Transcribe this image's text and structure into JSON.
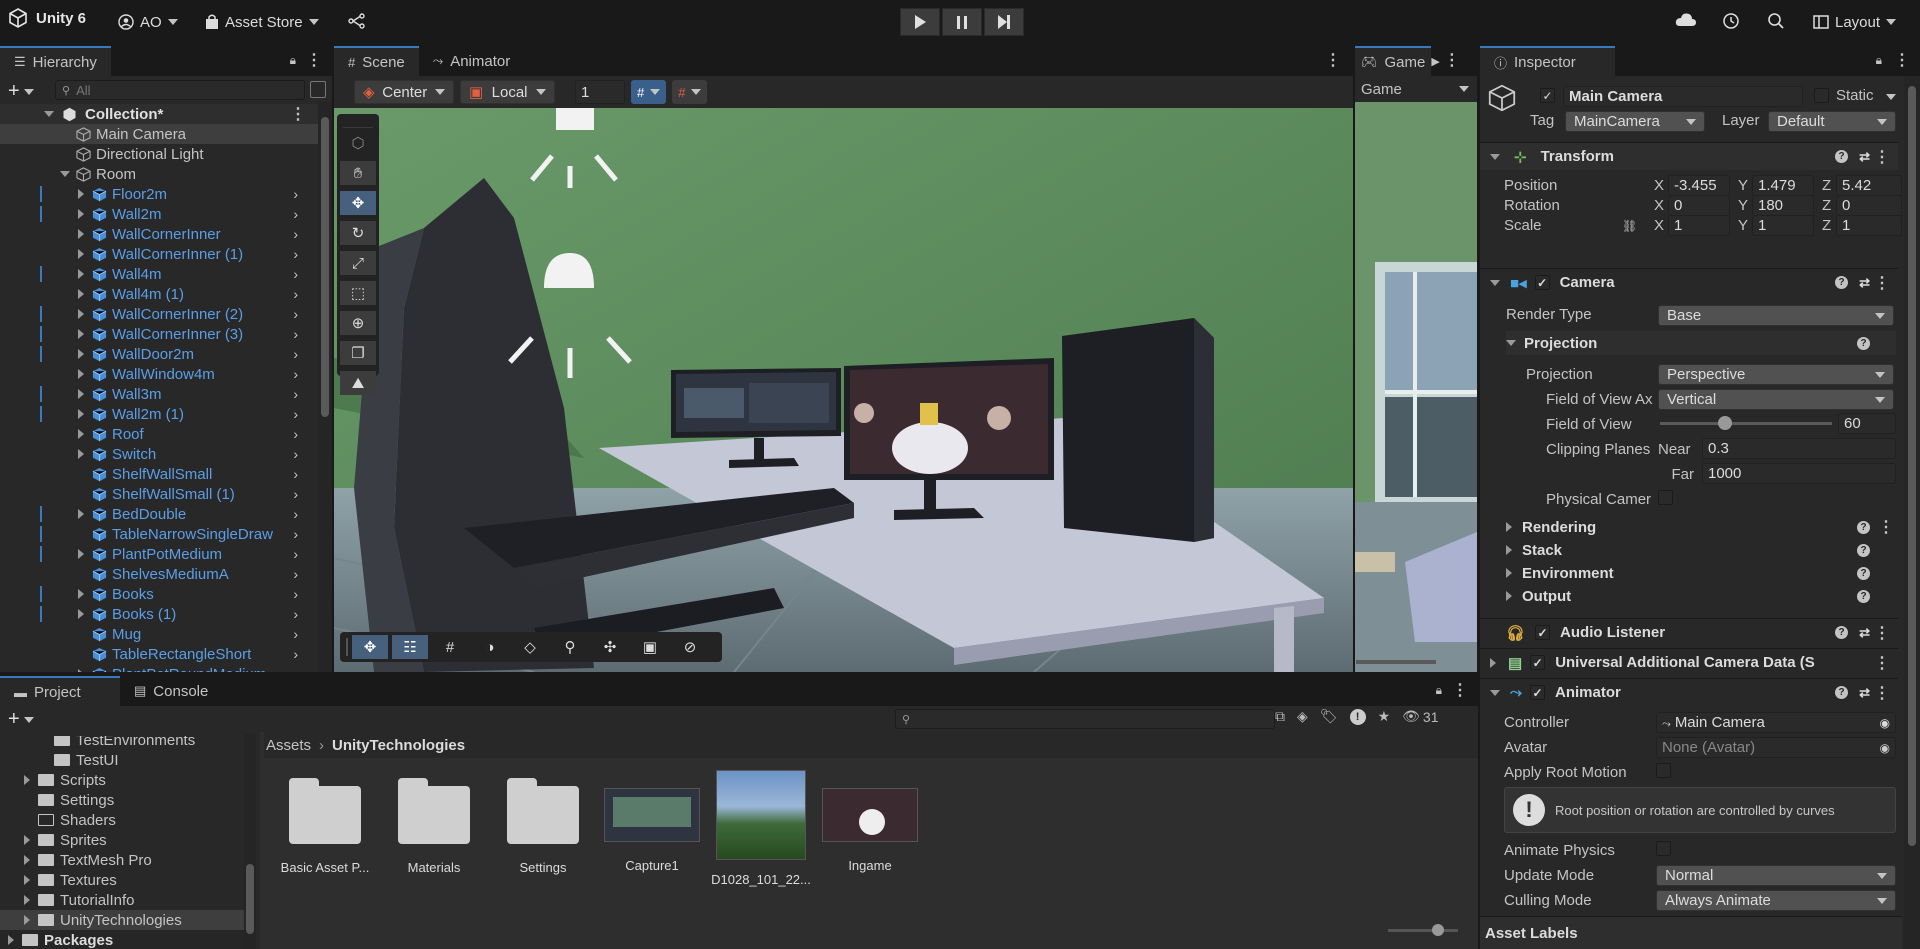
{
  "topbar": {
    "app_name": "Unity 6",
    "account": "AO",
    "asset_store": "Asset Store",
    "layout": "Layout"
  },
  "hierarchy": {
    "tab": "Hierarchy",
    "search_placeholder": "All",
    "scene": "Collection*",
    "items": [
      {
        "label": "Main Camera"
      },
      {
        "label": "Directional Light"
      },
      {
        "label": "Room"
      },
      {
        "label": "Floor2m"
      },
      {
        "label": "Wall2m"
      },
      {
        "label": "WallCornerInner"
      },
      {
        "label": "WallCornerInner (1)"
      },
      {
        "label": "Wall4m"
      },
      {
        "label": "Wall4m (1)"
      },
      {
        "label": "WallCornerInner (2)"
      },
      {
        "label": "WallCornerInner (3)"
      },
      {
        "label": "WallDoor2m"
      },
      {
        "label": "WallWindow4m"
      },
      {
        "label": "Wall3m"
      },
      {
        "label": "Wall2m (1)"
      },
      {
        "label": "Roof"
      },
      {
        "label": "Switch"
      },
      {
        "label": "ShelfWallSmall"
      },
      {
        "label": "ShelfWallSmall (1)"
      },
      {
        "label": "BedDouble"
      },
      {
        "label": "TableNarrowSingleDraw"
      },
      {
        "label": "PlantPotMedium"
      },
      {
        "label": "ShelvesMediumA"
      },
      {
        "label": "Books"
      },
      {
        "label": "Books (1)"
      },
      {
        "label": "Mug"
      },
      {
        "label": "TableRectangleShort"
      },
      {
        "label": "PlantPotRoundMedium"
      }
    ]
  },
  "scene": {
    "tabs": [
      "Scene",
      "Animator"
    ],
    "pivot": "Center",
    "space": "Local",
    "snap_value": "1"
  },
  "game": {
    "tab": "Game",
    "display": "Game"
  },
  "inspector": {
    "tab": "Inspector",
    "object_name": "Main Camera",
    "static_label": "Static",
    "tag_label": "Tag",
    "tag_value": "MainCamera",
    "layer_label": "Layer",
    "layer_value": "Default",
    "transform": {
      "title": "Transform",
      "position_label": "Position",
      "rotation_label": "Rotation",
      "scale_label": "Scale",
      "position": {
        "x": "-3.455",
        "y": "1.479",
        "z": "5.42"
      },
      "rotation": {
        "x": "0",
        "y": "180",
        "z": "0"
      },
      "scale": {
        "x": "1",
        "y": "1",
        "z": "1"
      },
      "axis_x": "X",
      "axis_y": "Y",
      "axis_z": "Z"
    },
    "camera": {
      "title": "Camera",
      "render_type_label": "Render Type",
      "render_type": "Base",
      "projection_section": "Projection",
      "projection_label": "Projection",
      "projection_value": "Perspective",
      "fov_axis_label": "Field of View Ax",
      "fov_axis_value": "Vertical",
      "fov_label": "Field of View",
      "fov_value": "60",
      "fov_slider_fraction": 0.38,
      "clipping_label": "Clipping Planes",
      "near_label": "Near",
      "near_value": "0.3",
      "far_label": "Far",
      "far_value": "1000",
      "physical_label": "Physical Camer",
      "sections": [
        "Rendering",
        "Stack",
        "Environment",
        "Output"
      ]
    },
    "audio_listener": "Audio Listener",
    "urp_data": "Universal Additional Camera Data (S",
    "animator": {
      "title": "Animator",
      "controller_label": "Controller",
      "controller_value": "Main Camera",
      "avatar_label": "Avatar",
      "avatar_value": "None (Avatar)",
      "root_motion_label": "Apply Root Motion",
      "info_text": "Root position or rotation are controlled by curves",
      "animate_physics_label": "Animate Physics",
      "update_mode_label": "Update Mode",
      "update_mode_value": "Normal",
      "culling_mode_label": "Culling Mode",
      "culling_mode_value": "Always Animate"
    },
    "asset_labels": "Asset Labels"
  },
  "project": {
    "tabs": [
      "Project",
      "Console"
    ],
    "hidden_count": "31",
    "breadcrumb_root": "Assets",
    "breadcrumb_current": "UnityTechnologies",
    "tree": [
      {
        "label": "TestEnvironments"
      },
      {
        "label": "TestUI"
      },
      {
        "label": "Scripts"
      },
      {
        "label": "Settings"
      },
      {
        "label": "Shaders"
      },
      {
        "label": "Sprites"
      },
      {
        "label": "TextMesh Pro"
      },
      {
        "label": "Textures"
      },
      {
        "label": "TutorialInfo"
      },
      {
        "label": "UnityTechnologies"
      },
      {
        "label": "Packages"
      }
    ],
    "assets": [
      {
        "label": "Basic Asset P..."
      },
      {
        "label": "Materials"
      },
      {
        "label": "Settings"
      },
      {
        "label": "Capture1"
      },
      {
        "label": "D1028_101_22..."
      },
      {
        "label": "Ingame"
      }
    ]
  }
}
